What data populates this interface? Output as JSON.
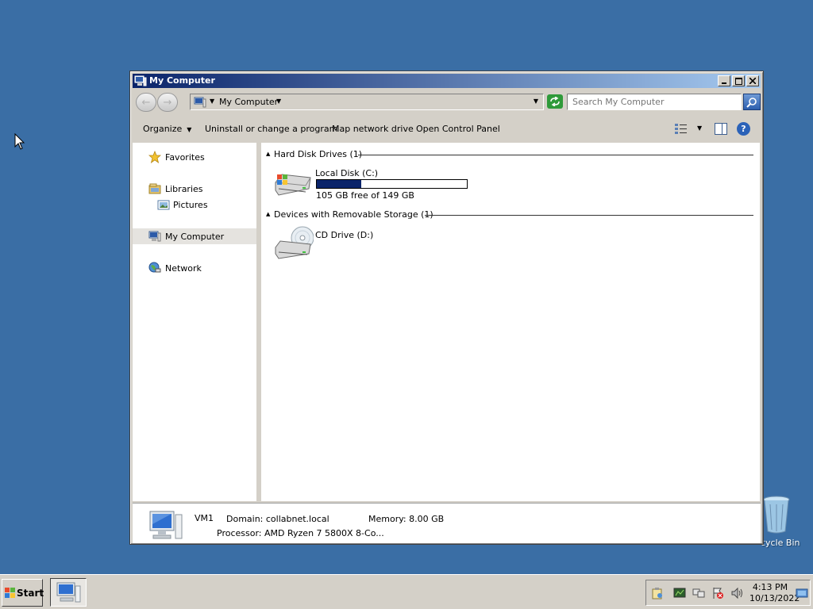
{
  "desktop": {
    "recycle_bin_label": "cycle Bin"
  },
  "window": {
    "title": "My Computer",
    "address": "My Computer",
    "search_placeholder": "Search My Computer"
  },
  "toolbar": {
    "organize": "Organize",
    "uninstall": "Uninstall or change a program",
    "map_drive": "Map network drive",
    "control_panel": "Open Control Panel"
  },
  "nav": {
    "favorites": "Favorites",
    "libraries": "Libraries",
    "pictures": "Pictures",
    "my_computer": "My Computer",
    "network": "Network"
  },
  "content": {
    "group_hdd": "Hard Disk Drives (1)",
    "group_removable": "Devices with Removable Storage (1)",
    "local_disk": {
      "name": "Local Disk (C:)",
      "free_text": "105 GB free of 149 GB",
      "used_fraction": 0.295
    },
    "cd_drive": {
      "name": "CD Drive (D:)"
    }
  },
  "details": {
    "computer_name": "VM1",
    "domain": "Domain: collabnet.local",
    "memory": "Memory: 8.00 GB",
    "processor": "Processor: AMD Ryzen 7 5800X 8-Co..."
  },
  "taskbar": {
    "start_label": "Start",
    "time": "4:13 PM",
    "date": "10/13/2022"
  },
  "colors": {
    "desktop": "#3a6ea5",
    "title_start": "#0a246a",
    "title_end": "#a6caf0",
    "capacity_fill": "#0a246a"
  }
}
